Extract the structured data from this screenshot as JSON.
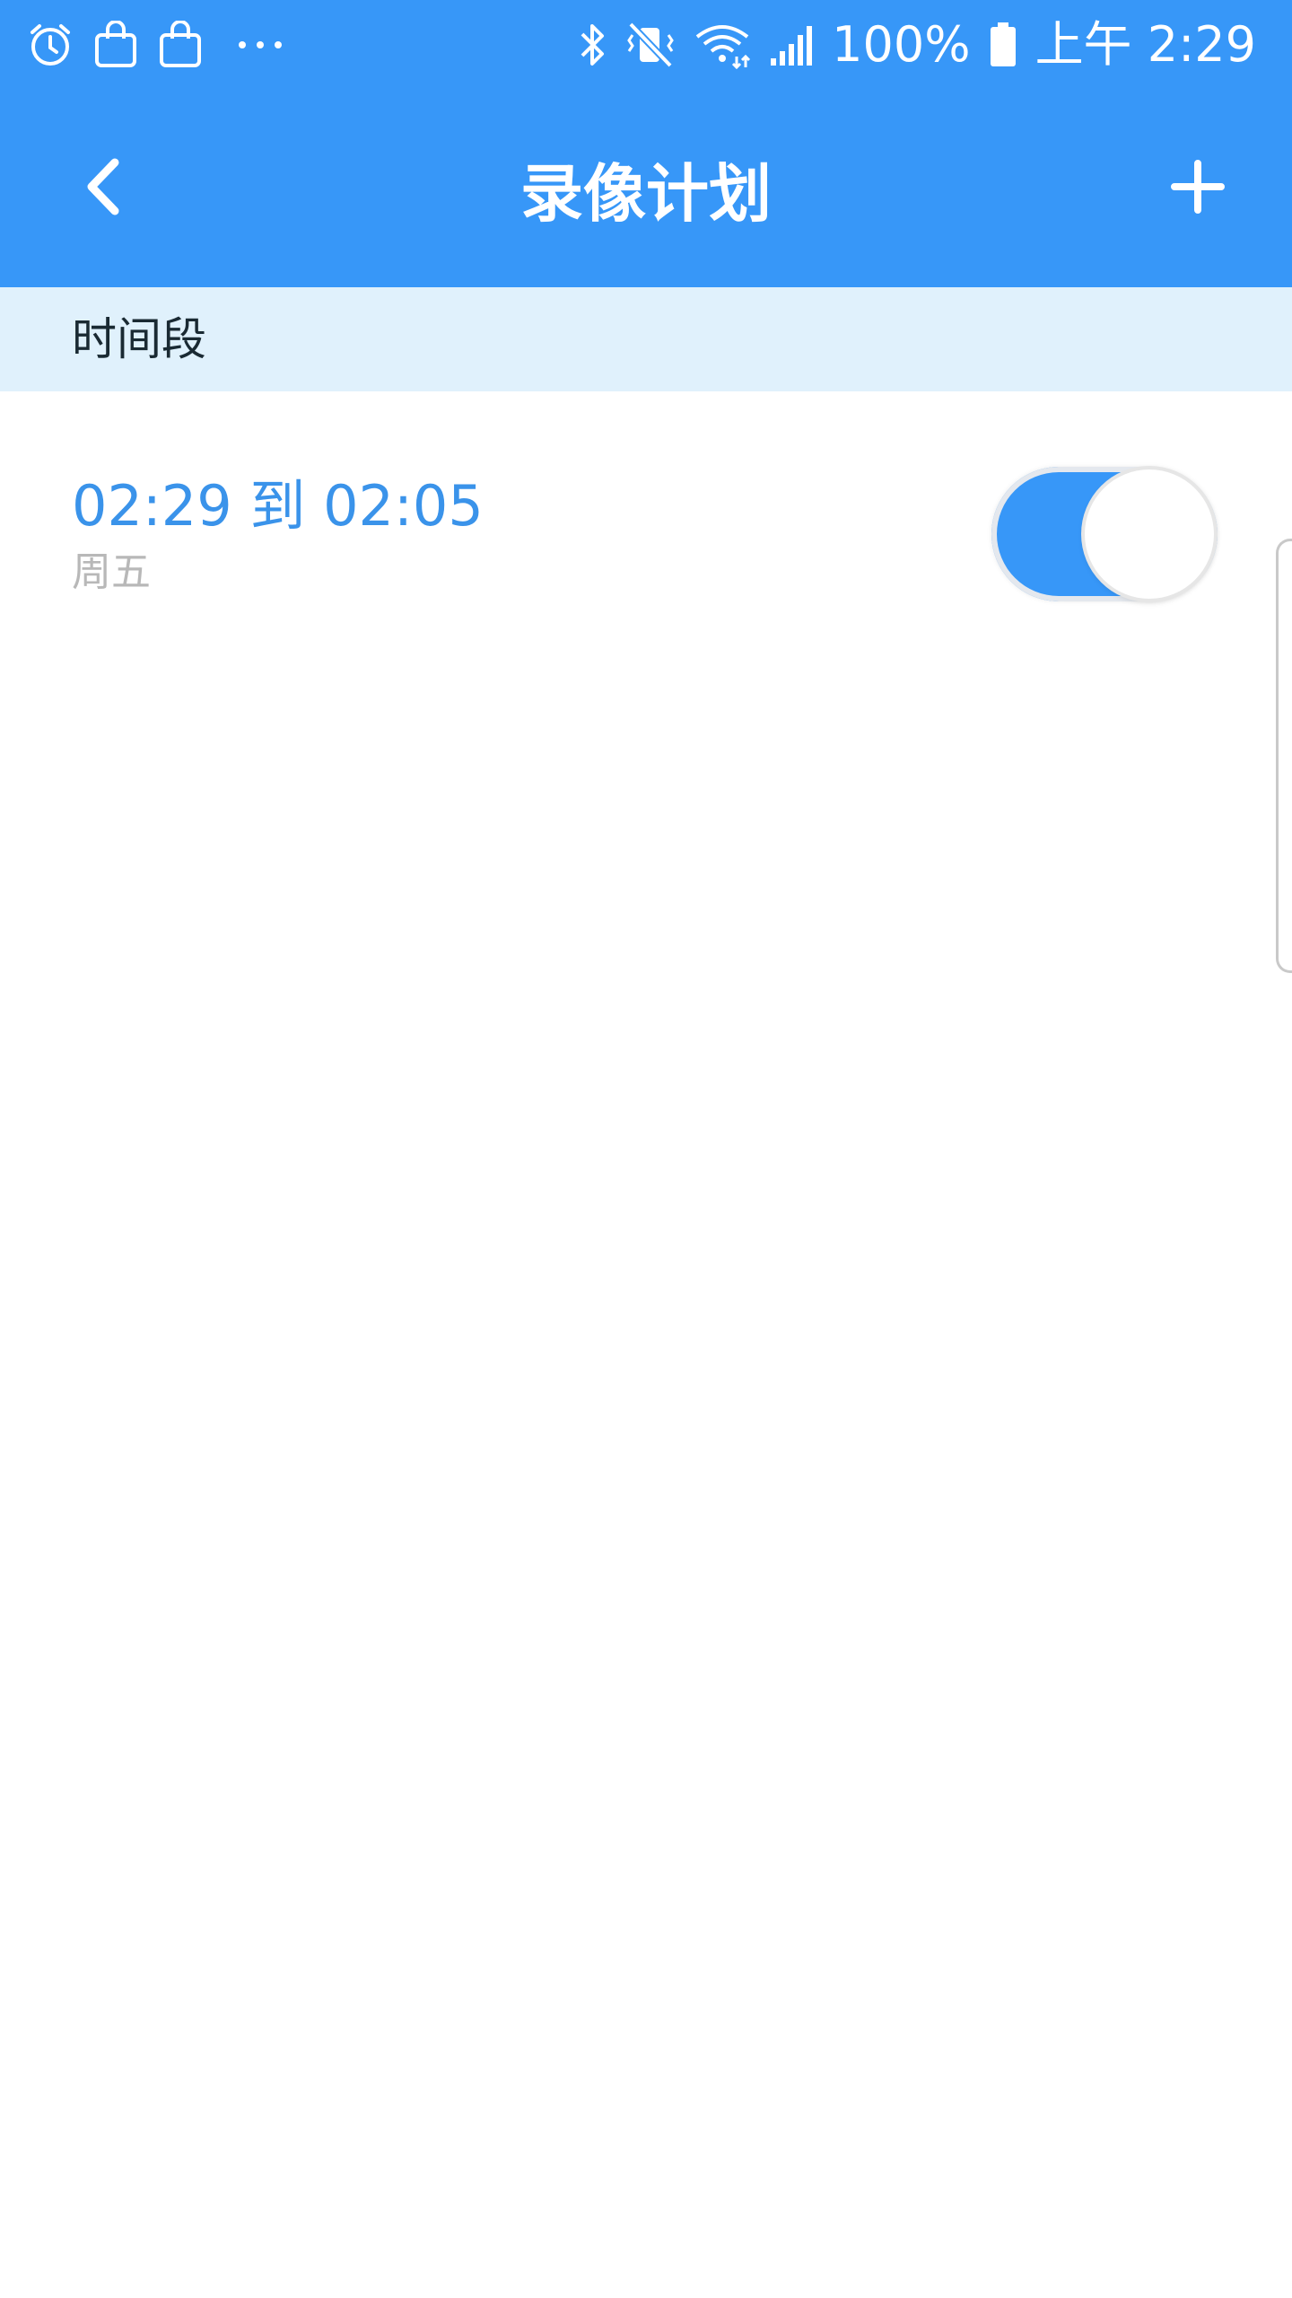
{
  "status_bar": {
    "battery_percent": "100%",
    "time": "上午 2:29",
    "icons": [
      "alarm-icon",
      "shopping-bag-icon",
      "shopping-bag-icon",
      "more-dots-icon",
      "bluetooth-icon",
      "vibrate-mute-icon",
      "wifi-icon",
      "signal-icon",
      "battery-icon"
    ]
  },
  "toolbar": {
    "title": "录像计划",
    "back_icon": "chevron-left-icon",
    "add_icon": "plus-icon"
  },
  "section": {
    "header_label": "时间段"
  },
  "schedules": [
    {
      "time_range": "02:29 到 02:05",
      "days": "周五",
      "enabled": true
    }
  ],
  "colors": {
    "primary": "#3797f8",
    "section_bg": "#e0f1fc",
    "time_text": "#3a93ea",
    "days_text": "#b8b8b8"
  }
}
